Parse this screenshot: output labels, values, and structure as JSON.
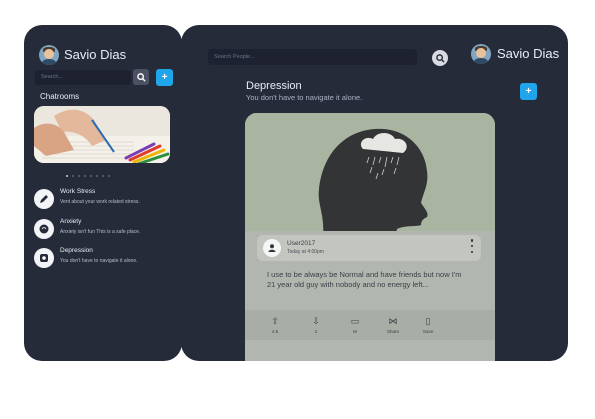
{
  "left": {
    "user_name": "Savio Dias",
    "search_placeholder": "Search...",
    "plus_label": "+",
    "section_title": "Chatrooms",
    "carousel_dots": 8,
    "carousel_active": 0,
    "rooms": [
      {
        "title": "Work Stress",
        "subtitle": "Vent about your work related stress.",
        "icon": "pencil-icon"
      },
      {
        "title": "Anxiety",
        "subtitle": "Anxiety isn't fun This is a safe place.",
        "icon": "anxiety-icon"
      },
      {
        "title": "Depression",
        "subtitle": "You don't have to navigate it alone.",
        "icon": "depression-icon"
      }
    ]
  },
  "right": {
    "search_placeholder": "Search People...",
    "user_name": "Savio Dias",
    "channel_title": "Depression",
    "channel_subtitle": "You don't have to navigate it alone.",
    "plus_label": "+",
    "post": {
      "user": "User2017",
      "time": "Today at 4:00pm",
      "text": "I use to be always be Normal and have friends but now I'm 21 year old guy with nobody and no energy left...",
      "actions": [
        {
          "name": "upvote",
          "icon": "arrow-up-icon",
          "glyph": "⇧",
          "count": "4.5"
        },
        {
          "name": "downvote",
          "icon": "arrow-down-icon",
          "glyph": "⇩",
          "count": "2"
        },
        {
          "name": "comment",
          "icon": "comment-icon",
          "glyph": "▭",
          "count": "M"
        },
        {
          "name": "share",
          "icon": "share-icon",
          "glyph": "⋈",
          "count": "Share"
        },
        {
          "name": "save",
          "icon": "bookmark-icon",
          "glyph": "▯",
          "count": "Save"
        }
      ]
    }
  },
  "colors": {
    "panel": "#262b3a",
    "accent": "#21a5ea",
    "search_bg": "#1d2130"
  }
}
